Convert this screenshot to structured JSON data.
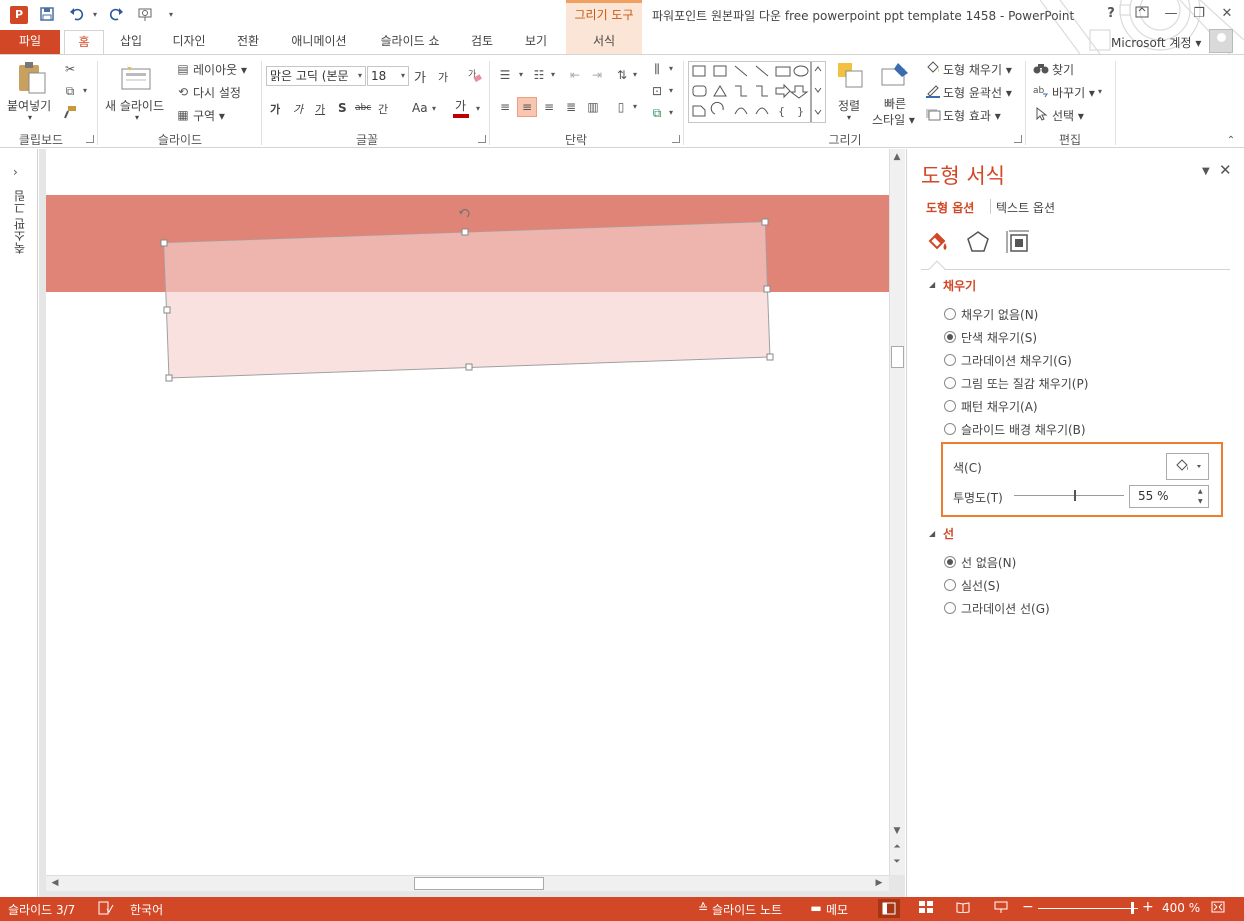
{
  "title_bar": {
    "app_logo": "P",
    "contextual_group": "그리기 도구",
    "window_title": "파워포인트 원본파일 다운 free powerpoint ppt template 1458 - PowerPoint",
    "help": "?",
    "min": "—",
    "restore": "❐",
    "close": "✕"
  },
  "tabs": [
    {
      "label": "파일"
    },
    {
      "label": "홈"
    },
    {
      "label": "삽입"
    },
    {
      "label": "디자인"
    },
    {
      "label": "전환"
    },
    {
      "label": "애니메이션"
    },
    {
      "label": "슬라이드 쇼"
    },
    {
      "label": "검토"
    },
    {
      "label": "보기"
    },
    {
      "label": "서식"
    }
  ],
  "account": "Microsoft 계정 ▾",
  "ribbon": {
    "clipboard": {
      "paste": "붙여넣기",
      "label": "클립보드"
    },
    "slides": {
      "new_slide": "새 슬라이드",
      "layout": "레이아웃 ▾",
      "reset": "다시 설정",
      "section": "구역 ▾",
      "label": "슬라이드"
    },
    "font": {
      "font_name": "맑은 고딕 (본문",
      "font_size": "18",
      "grow": "가",
      "shrink": "가",
      "bold": "가",
      "italic": "가",
      "underline": "가",
      "shadow": "S",
      "strike": "abc",
      "spacing": "간",
      "case": "Aa",
      "color": "가",
      "label": "글꼴"
    },
    "paragraph": {
      "label": "단락"
    },
    "drawing": {
      "arrange": "정렬",
      "quick_styles": "빠른",
      "quick_styles2": "스타일 ▾",
      "fill": "도형 채우기 ▾",
      "outline": "도형 윤곽선 ▾",
      "effects": "도형 효과 ▾",
      "label": "그리기"
    },
    "editing": {
      "find": "찾기",
      "replace": "바꾸기 ▾",
      "select": "선택 ▾",
      "label": "편집"
    }
  },
  "thumbnail_pane": {
    "label": "축소판 그림",
    "expand": "›"
  },
  "format_pane": {
    "title": "도형 서식",
    "tab_shape": "도형 옵션",
    "tab_text": "텍스트 옵션",
    "fill_section": "채우기",
    "fill_options": [
      {
        "label": "채우기 없음(N)",
        "selected": false
      },
      {
        "label": "단색 채우기(S)",
        "selected": true
      },
      {
        "label": "그라데이션 채우기(G)",
        "selected": false
      },
      {
        "label": "그림 또는 질감 채우기(P)",
        "selected": false
      },
      {
        "label": "패턴 채우기(A)",
        "selected": false
      },
      {
        "label": "슬라이드 배경 채우기(B)",
        "selected": false
      }
    ],
    "color_label": "색(C)",
    "transparency_label": "투명도(T)",
    "transparency_value": "55 %",
    "transparency_fraction": 0.55,
    "line_section": "선",
    "line_options": [
      {
        "label": "선 없음(N)",
        "selected": true
      },
      {
        "label": "실선(S)",
        "selected": false
      },
      {
        "label": "그라데이션 선(G)",
        "selected": false
      }
    ]
  },
  "status_bar": {
    "slide_info": "슬라이드 3/7",
    "language": "한국어",
    "notes": "슬라이드 노트",
    "comments": "메모",
    "zoom": "400 %"
  },
  "colors": {
    "accent": "#d24726",
    "banner": "#e08478",
    "shape_fill": "#f0bdb7",
    "highlight": "#ed7d31"
  }
}
